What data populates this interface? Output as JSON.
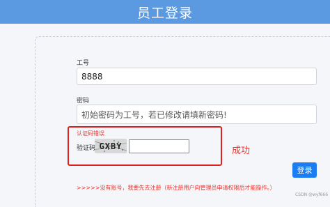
{
  "header": {
    "title": "员工登录"
  },
  "form": {
    "employee_id_label": "工号",
    "employee_id_value": "8888",
    "password_label": "密码",
    "password_placeholder": "初始密码为工号，若已修改请填新密码!",
    "captcha_error": "认证码错误",
    "captcha_label": "验证码:",
    "captcha_code": "GXBY",
    "captcha_input_value": "",
    "login_button": "登录",
    "footer_note": ">>>>>没有账号，我要先去注册（新注册用户向管理员申请权限后才能操作。）"
  },
  "annotation": {
    "success_text": "成功"
  },
  "watermark": "CSDN @wyf666",
  "colors": {
    "header_bg": "#5b9ae0",
    "button_bg": "#1a7df2",
    "error_red": "#e53935",
    "annotation_box": "#e02020"
  }
}
